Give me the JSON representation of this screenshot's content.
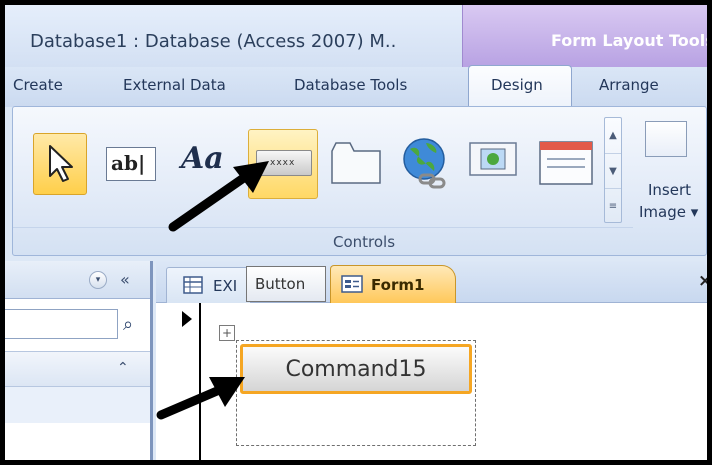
{
  "window": {
    "title": "Database1 : Database (Access 2007) M..",
    "context_tab": "Form Layout Tools"
  },
  "tabs": {
    "create": "Create",
    "external_data": "External Data",
    "database_tools": "Database Tools",
    "design": "Design",
    "arrange": "Arrange"
  },
  "ribbon": {
    "group_label": "Controls",
    "textbox_glyph": "ab|",
    "label_glyph": "Aa",
    "button_glyph": "xxxx",
    "insert_image_line1": "Insert",
    "insert_image_line2": "Image ▾"
  },
  "nav": {
    "dropdown_glyph": "▾",
    "collapse_glyph": "«",
    "group_chevron": "⌃"
  },
  "doc_tabs": {
    "ex_tab": "EXI",
    "form_tab": "Form1",
    "close": "×"
  },
  "tooltip": "Button",
  "form": {
    "command_button": "Command15",
    "move_handle": "+"
  },
  "colors": {
    "accent_orange": "#f5a623",
    "ribbon_blue": "#dde8f6",
    "context_purple": "#b8a2e3"
  }
}
